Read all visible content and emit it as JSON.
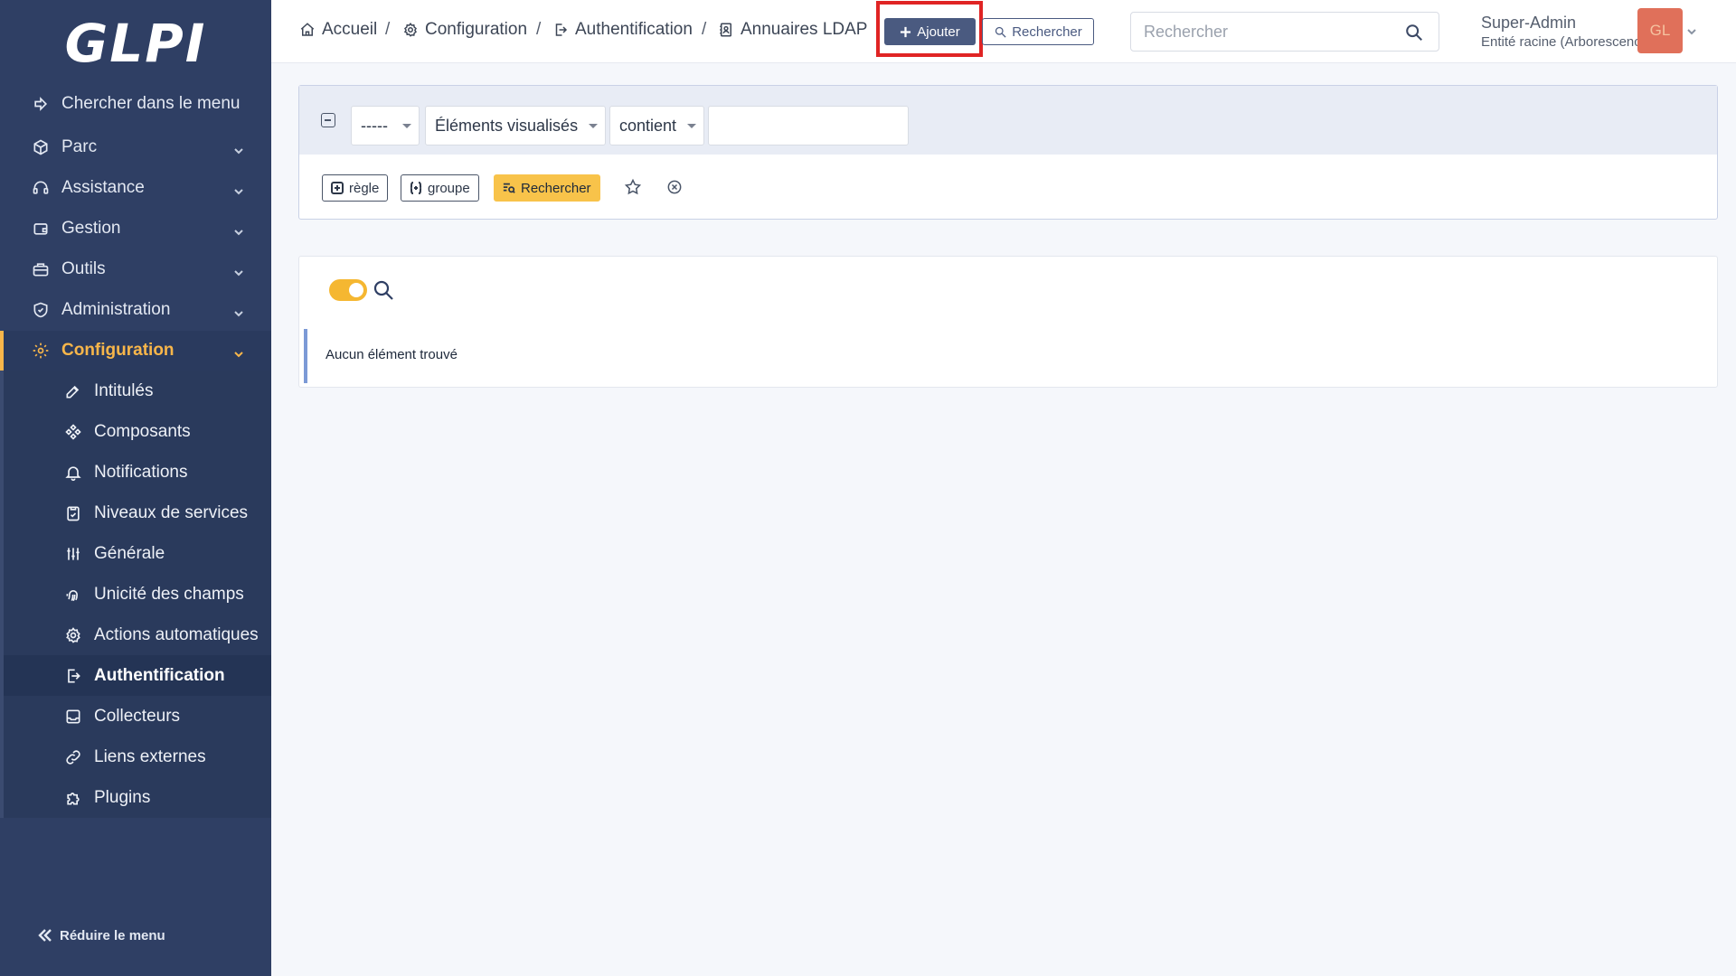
{
  "app": {
    "logo": "GLPI"
  },
  "sidebar": {
    "search_label": "Chercher dans le menu",
    "items": [
      {
        "label": "Parc",
        "icon": "box-icon"
      },
      {
        "label": "Assistance",
        "icon": "headset-icon"
      },
      {
        "label": "Gestion",
        "icon": "wallet-icon"
      },
      {
        "label": "Outils",
        "icon": "briefcase-icon"
      },
      {
        "label": "Administration",
        "icon": "shield-icon"
      },
      {
        "label": "Configuration",
        "icon": "gear-icon",
        "active": true
      }
    ],
    "sub_items": [
      {
        "label": "Intitulés",
        "icon": "edit-icon"
      },
      {
        "label": "Composants",
        "icon": "components-icon"
      },
      {
        "label": "Notifications",
        "icon": "bell-icon"
      },
      {
        "label": "Niveaux de services",
        "icon": "clipboard-check-icon"
      },
      {
        "label": "Générale",
        "icon": "sliders-icon"
      },
      {
        "label": "Unicité des champs",
        "icon": "fingerprint-icon"
      },
      {
        "label": "Actions automatiques",
        "icon": "gear-cycle-icon"
      },
      {
        "label": "Authentification",
        "icon": "login-icon",
        "current": true
      },
      {
        "label": "Collecteurs",
        "icon": "inbox-icon"
      },
      {
        "label": "Liens externes",
        "icon": "link-icon"
      },
      {
        "label": "Plugins",
        "icon": "puzzle-icon"
      }
    ],
    "collapse_label": "Réduire le menu"
  },
  "header": {
    "breadcrumb": [
      {
        "label": "Accueil",
        "icon": "home-icon"
      },
      {
        "label": "Configuration",
        "icon": "gear-icon"
      },
      {
        "label": "Authentification",
        "icon": "login-icon"
      },
      {
        "label": "Annuaires LDAP",
        "icon": "address-book-icon"
      }
    ],
    "separator": "/",
    "add_label": "Ajouter",
    "search_label": "Rechercher",
    "global_search_placeholder": "Rechercher",
    "user_name": "Super-Admin",
    "user_entity": "Entité racine (Arborescence)",
    "avatar_initials": "GL"
  },
  "criteria": {
    "field_select": "-----",
    "view_select": "Éléments visualisés",
    "operator_select": "contient",
    "value": "",
    "rule_button": "règle",
    "group_button": "groupe",
    "search_button": "Rechercher"
  },
  "results": {
    "empty_message": "Aucun élément trouvé"
  },
  "colors": {
    "sidebar_bg": "#2f3f64",
    "accent": "#f8b64a",
    "primary_button": "#4a5a80",
    "highlight": "#e02424"
  }
}
